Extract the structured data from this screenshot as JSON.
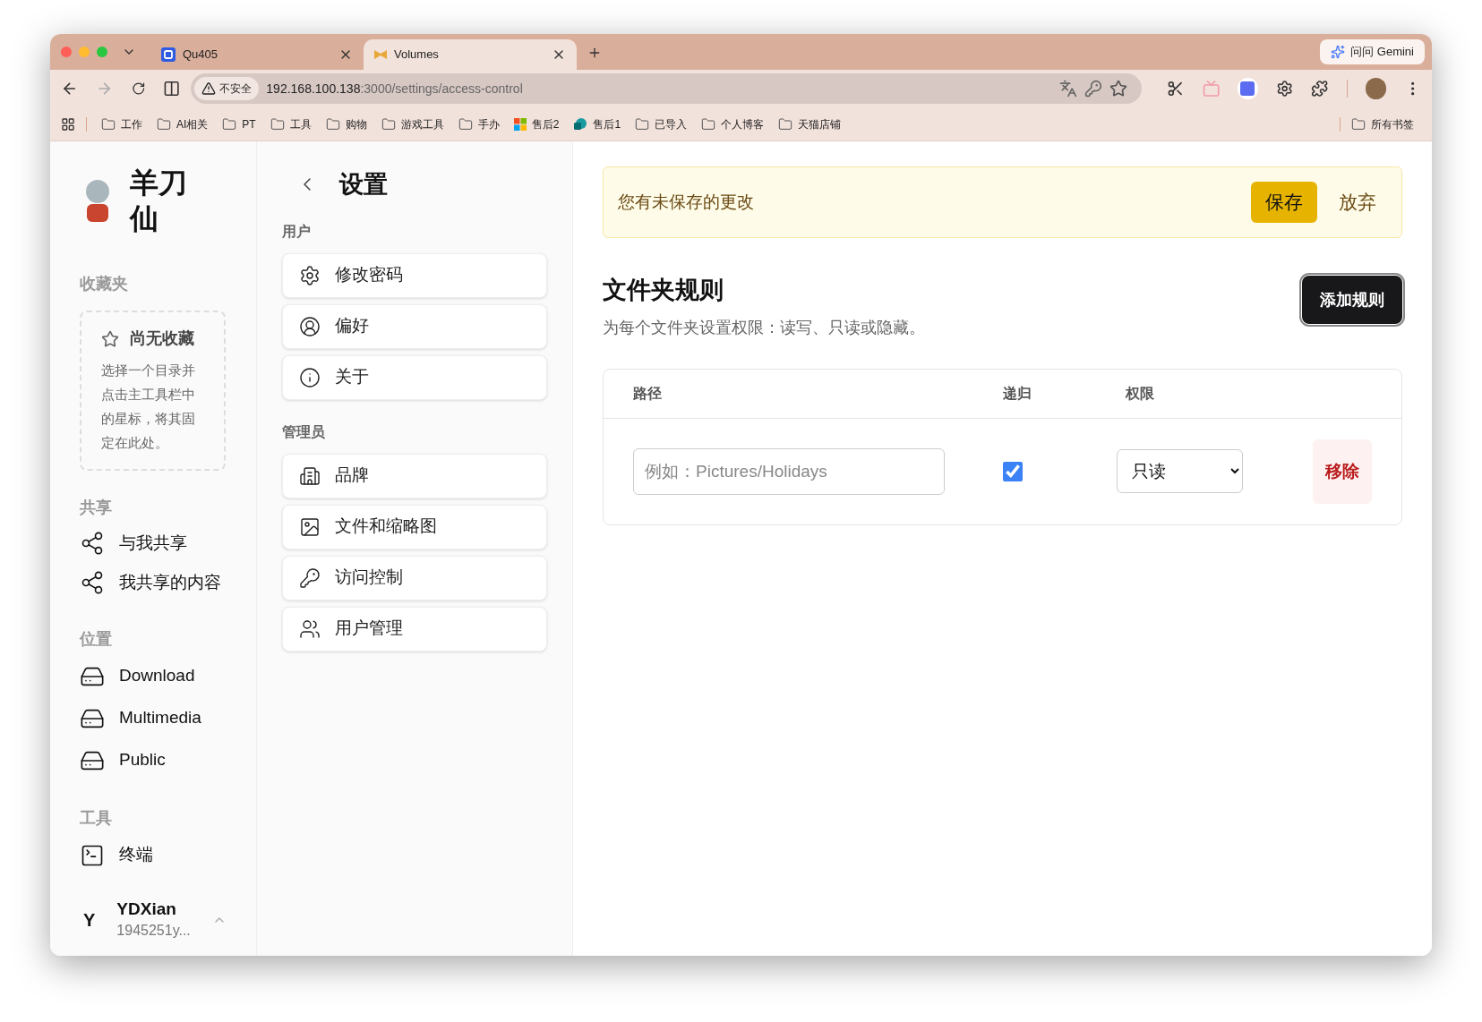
{
  "browser": {
    "tabs": [
      {
        "title": "Qu405",
        "selected": false
      },
      {
        "title": "Volumes",
        "selected": true
      }
    ],
    "gemini": "问问 Gemini",
    "security": "不安全",
    "url_host": "192.168.100.138",
    "url_rest": ":3000/settings/access-control",
    "bookmarks": [
      {
        "kind": "folder",
        "label": "工作"
      },
      {
        "kind": "folder",
        "label": "AI相关"
      },
      {
        "kind": "folder",
        "label": "PT"
      },
      {
        "kind": "folder",
        "label": "工具"
      },
      {
        "kind": "folder",
        "label": "购物"
      },
      {
        "kind": "folder",
        "label": "游戏工具"
      },
      {
        "kind": "folder",
        "label": "手办"
      },
      {
        "kind": "tiles",
        "label": "售后2"
      },
      {
        "kind": "app",
        "label": "售后1"
      },
      {
        "kind": "folder",
        "label": "已导入"
      },
      {
        "kind": "folder",
        "label": "个人博客"
      },
      {
        "kind": "folder",
        "label": "天猫店铺"
      }
    ],
    "all_bookmarks": "所有书签"
  },
  "sidebar": {
    "title": "羊刀仙",
    "favorites": {
      "heading": "收藏夹",
      "empty_title": "尚无收藏",
      "empty_text": "选择一个目录并点击主工具栏中的星标，将其固定在此处。"
    },
    "sections": [
      {
        "heading": "共享",
        "items": [
          {
            "kind": "share",
            "label": "与我共享"
          },
          {
            "kind": "share",
            "label": "我共享的内容"
          }
        ]
      },
      {
        "heading": "位置",
        "items": [
          {
            "kind": "drive",
            "label": "Download"
          },
          {
            "kind": "drive",
            "label": "Multimedia"
          },
          {
            "kind": "drive",
            "label": "Public"
          }
        ]
      },
      {
        "heading": "工具",
        "items": [
          {
            "kind": "terminal",
            "label": "终端"
          }
        ]
      }
    ],
    "user": {
      "initial": "Y",
      "name": "YDXian",
      "id": "1945251y..."
    }
  },
  "settings": {
    "title": "设置",
    "groups": [
      {
        "heading": "用户",
        "items": [
          {
            "kind": "gear",
            "label": "修改密码"
          },
          {
            "kind": "user",
            "label": "偏好"
          },
          {
            "kind": "info",
            "label": "关于"
          }
        ]
      },
      {
        "heading": "管理员",
        "items": [
          {
            "kind": "building",
            "label": "品牌"
          },
          {
            "kind": "image",
            "label": "文件和缩略图"
          },
          {
            "kind": "key",
            "label": "访问控制"
          },
          {
            "kind": "users",
            "label": "用户管理"
          }
        ]
      }
    ]
  },
  "main": {
    "banner": {
      "text": "您有未保存的更改",
      "save": "保存",
      "discard": "放弃"
    },
    "title": "文件夹规则",
    "subtitle": "为每个文件夹设置权限：读写、只读或隐藏。",
    "add_button": "添加规则",
    "table": {
      "columns": [
        "路径",
        "递归",
        "权限"
      ],
      "rows": [
        {
          "path_placeholder": "例如：Pictures/Holidays",
          "recursive": true,
          "permission": "只读",
          "remove": "移除"
        }
      ]
    }
  }
}
